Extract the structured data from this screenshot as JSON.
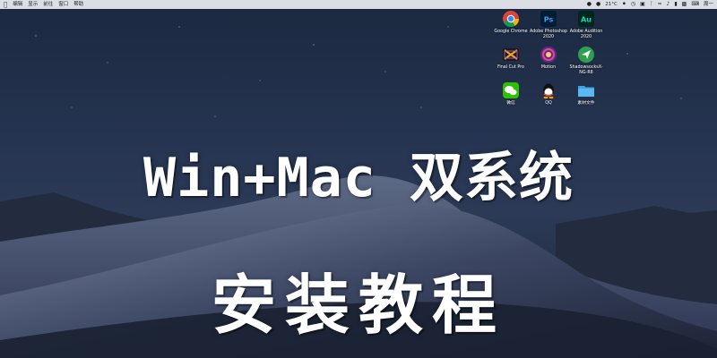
{
  "menubar": {
    "items": [
      "编辑",
      "显示",
      "前往",
      "窗口",
      "帮助"
    ],
    "status": {
      "temperature": "21°C",
      "clock": "周一"
    }
  },
  "desktop_icons": [
    {
      "label": "Google Chrome",
      "icon": "chrome-icon"
    },
    {
      "label": "Adobe Photoshop 2020",
      "icon": "photoshop-icon",
      "mark": "Ps"
    },
    {
      "label": "Adobe Audition 2020",
      "icon": "audition-icon",
      "mark": "Au"
    },
    {
      "label": "Final Cut Pro",
      "icon": "final-cut-pro-icon"
    },
    {
      "label": "Motion",
      "icon": "motion-icon"
    },
    {
      "label": "ShadowsocksX-NG-R8",
      "icon": "shadowsocks-icon"
    },
    {
      "label": "微信",
      "icon": "wechat-icon"
    },
    {
      "label": "QQ",
      "icon": "qq-icon"
    },
    {
      "label": "素材文件",
      "icon": "folder-icon"
    }
  ],
  "headline": {
    "line1": "Win+Mac 双系统",
    "line2": "安装教程"
  },
  "colors": {
    "photoshop": "#31A8FF",
    "audition": "#00E4BB",
    "folder": "#5BB8F0",
    "shadowsocks": "#2E9E4F"
  }
}
